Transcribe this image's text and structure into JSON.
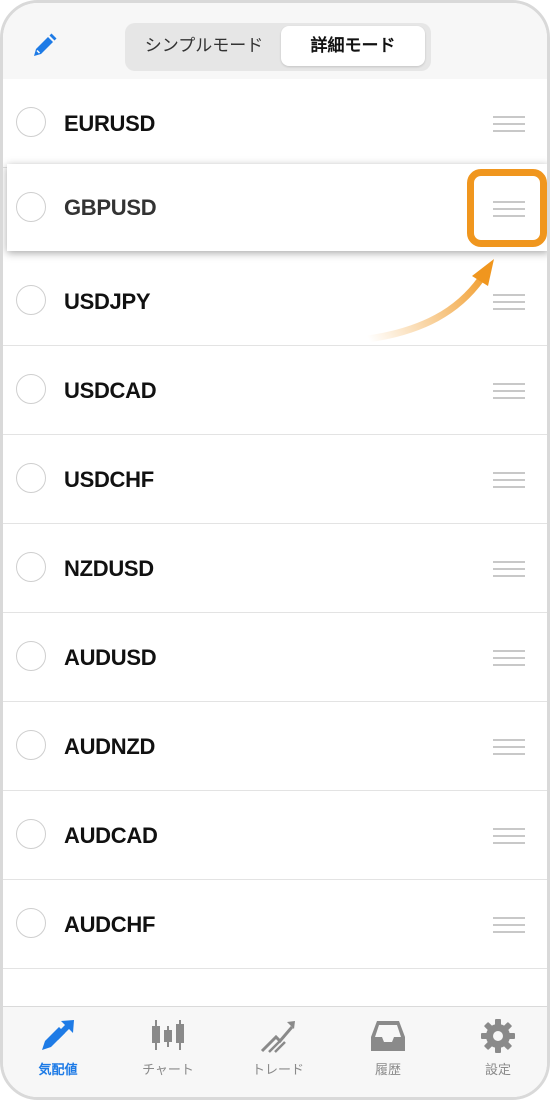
{
  "header": {
    "edit_icon": "pencil-icon",
    "segment": {
      "simple_label": "シンプルモード",
      "detail_label": "詳細モード",
      "selected": "詳細モード"
    }
  },
  "symbols": [
    {
      "name": "EURUSD"
    },
    {
      "name": "GBPUSD",
      "state": "dragging"
    },
    {
      "name": "USDJPY"
    },
    {
      "name": "USDCAD"
    },
    {
      "name": "USDCHF"
    },
    {
      "name": "NZDUSD"
    },
    {
      "name": "AUDUSD"
    },
    {
      "name": "AUDNZD"
    },
    {
      "name": "AUDCAD"
    },
    {
      "name": "AUDCHF"
    }
  ],
  "highlight": {
    "color": "#f0961e",
    "target": "GBPUSD reorder handle"
  },
  "tabbar": {
    "items": [
      {
        "label": "気配値",
        "icon": "quotes-arrows-icon",
        "active": true
      },
      {
        "label": "チャート",
        "icon": "candlestick-chart-icon",
        "active": false
      },
      {
        "label": "トレード",
        "icon": "trade-chart-icon",
        "active": false
      },
      {
        "label": "履歴",
        "icon": "history-inbox-icon",
        "active": false
      },
      {
        "label": "設定",
        "icon": "gear-icon",
        "active": false
      }
    ],
    "active_color": "#1e7be6"
  }
}
